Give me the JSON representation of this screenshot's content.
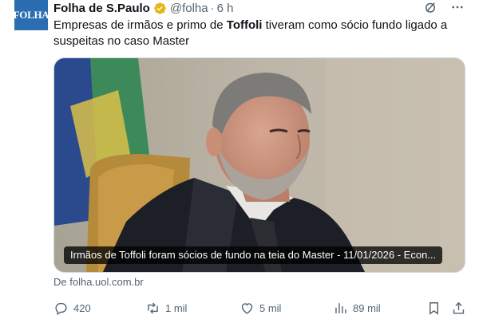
{
  "post": {
    "avatar_text": "FOLHA",
    "author_name": "Folha de S.Paulo",
    "handle": "@folha",
    "separator": "·",
    "time": "6 h",
    "text_before": "Empresas de irmãos e primo de ",
    "text_bold": "Toffoli",
    "text_after": " tiveram como sócio fundo ligado a suspeitas no caso Master",
    "media_caption": "Irmãos de Toffoli foram sócios de fundo na teia do Master - 11/01/2026 - Econ...",
    "source": "De folha.uol.com.br",
    "verified_color": "#e2b719"
  },
  "actions": {
    "replies": "420",
    "reposts": "1 mil",
    "likes": "5 mil",
    "views": "89 mil"
  },
  "icons": [
    "grok-icon",
    "more-icon",
    "reply-icon",
    "repost-icon",
    "like-icon",
    "views-icon",
    "bookmark-icon",
    "share-icon"
  ]
}
